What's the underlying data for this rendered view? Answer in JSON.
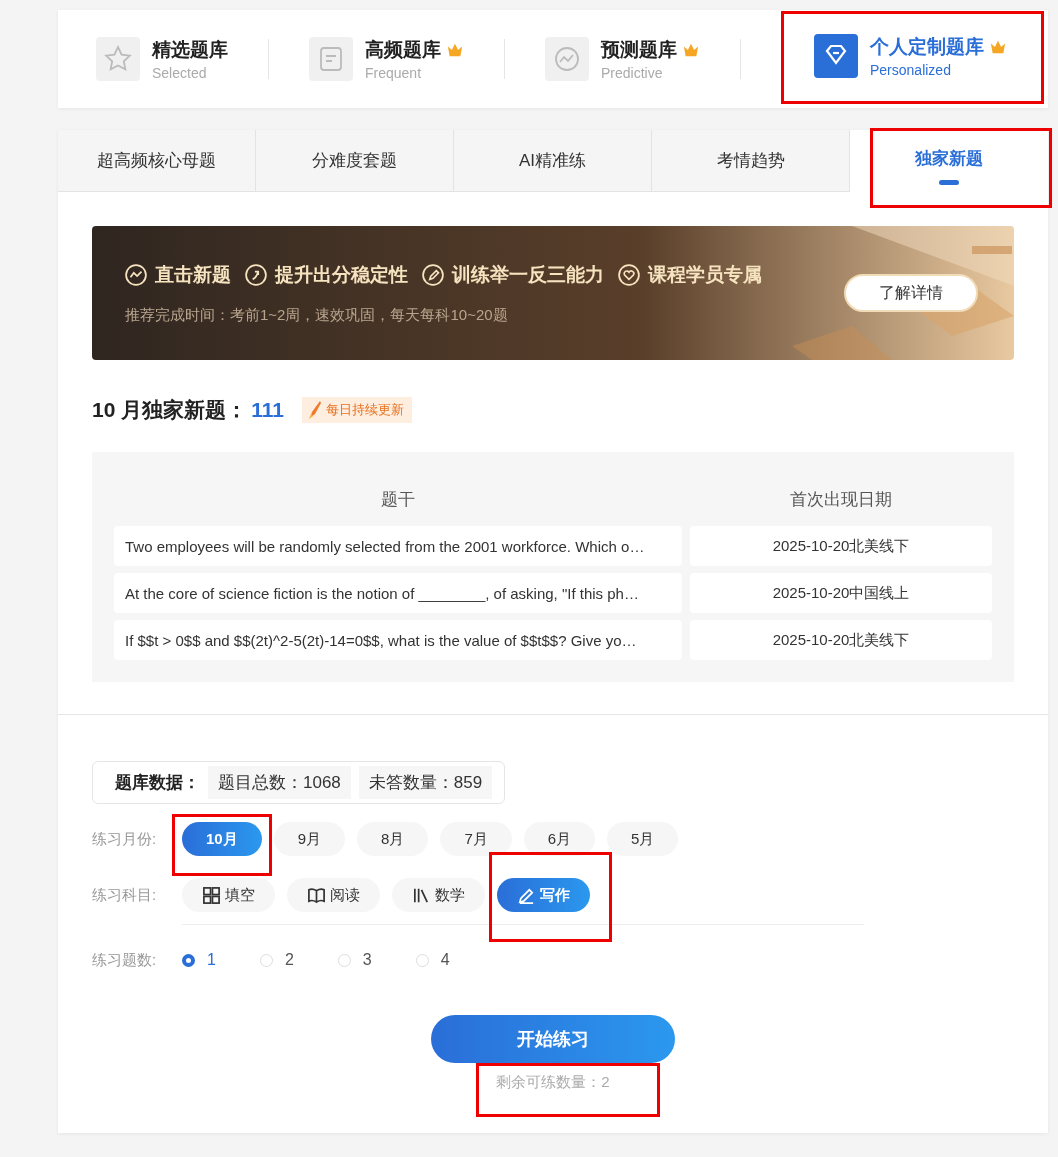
{
  "banks": [
    {
      "kind": "star",
      "title": "精选题库",
      "subtitle": "Selected",
      "premium": false,
      "selected": false,
      "highlighted": false
    },
    {
      "kind": "doc",
      "title": "高频题库",
      "subtitle": "Frequent",
      "premium": true,
      "selected": false,
      "highlighted": false
    },
    {
      "kind": "trend",
      "title": "预测题库",
      "subtitle": "Predictive",
      "premium": true,
      "selected": false,
      "highlighted": false
    },
    {
      "kind": "gem",
      "title": "个人定制题库",
      "subtitle": "Personalized",
      "premium": true,
      "selected": true,
      "highlighted": true
    }
  ],
  "tabs": [
    {
      "label": "超高频核心母题",
      "selected": false,
      "highlighted": false
    },
    {
      "label": "分难度套题",
      "selected": false,
      "highlighted": false
    },
    {
      "label": "AI精准练",
      "selected": false,
      "highlighted": false
    },
    {
      "label": "考情趋势",
      "selected": false,
      "highlighted": false
    },
    {
      "label": "独家新题",
      "selected": true,
      "highlighted": true
    }
  ],
  "banner": {
    "features": [
      {
        "kind": "trend",
        "label": "直击新题"
      },
      {
        "kind": "up",
        "label": "提升出分稳定性"
      },
      {
        "kind": "pencil",
        "label": "训练举一反三能力"
      },
      {
        "kind": "heart",
        "label": "课程学员专属"
      }
    ],
    "note": "推荐完成时间：考前1~2周，速效巩固，每天每科10~20题",
    "button": "了解详情"
  },
  "heading": {
    "title": "10 月独家新题：",
    "count": "111",
    "badge": "每日持续更新"
  },
  "table": {
    "columns": [
      "题干",
      "首次出现日期"
    ],
    "rows": [
      [
        "Two employees will be randomly selected from the 2001 workforce. Which o…",
        "2025-10-20北美线下"
      ],
      [
        "At the core of science fiction is the notion of ________, of asking, \"If this ph…",
        "2025-10-20中国线上"
      ],
      [
        "If $$t > 0$$ and $$(2t)^2-5(2t)-14=0$$, what is the value of $$t$$? Give yo…",
        "2025-10-20北美线下"
      ]
    ]
  },
  "stats": {
    "label": "题库数据：",
    "items": [
      "题目总数：1068",
      "未答数量：859"
    ]
  },
  "months": {
    "label": "练习月份:",
    "options": [
      {
        "label": "10月",
        "selected": true,
        "highlighted": true
      },
      {
        "label": "9月",
        "selected": false,
        "highlighted": false
      },
      {
        "label": "8月",
        "selected": false,
        "highlighted": false
      },
      {
        "label": "7月",
        "selected": false,
        "highlighted": false
      },
      {
        "label": "6月",
        "selected": false,
        "highlighted": false
      },
      {
        "label": "5月",
        "selected": false,
        "highlighted": false
      }
    ]
  },
  "subjects": {
    "label": "练习科目:",
    "options": [
      {
        "kind": "grid",
        "label": "填空",
        "selected": false,
        "highlighted": false
      },
      {
        "kind": "book",
        "label": "阅读",
        "selected": false,
        "highlighted": false
      },
      {
        "kind": "books",
        "label": "数学",
        "selected": false,
        "highlighted": false
      },
      {
        "kind": "pencil",
        "label": "写作",
        "selected": true,
        "highlighted": true
      }
    ]
  },
  "counts": {
    "label": "练习题数:",
    "options": [
      {
        "label": "1",
        "selected": true
      },
      {
        "label": "2",
        "selected": false
      },
      {
        "label": "3",
        "selected": false
      },
      {
        "label": "4",
        "selected": false
      }
    ]
  },
  "start_button": "开始练习",
  "remaining": {
    "text": "剩余可练数量：2",
    "highlighted": true
  }
}
